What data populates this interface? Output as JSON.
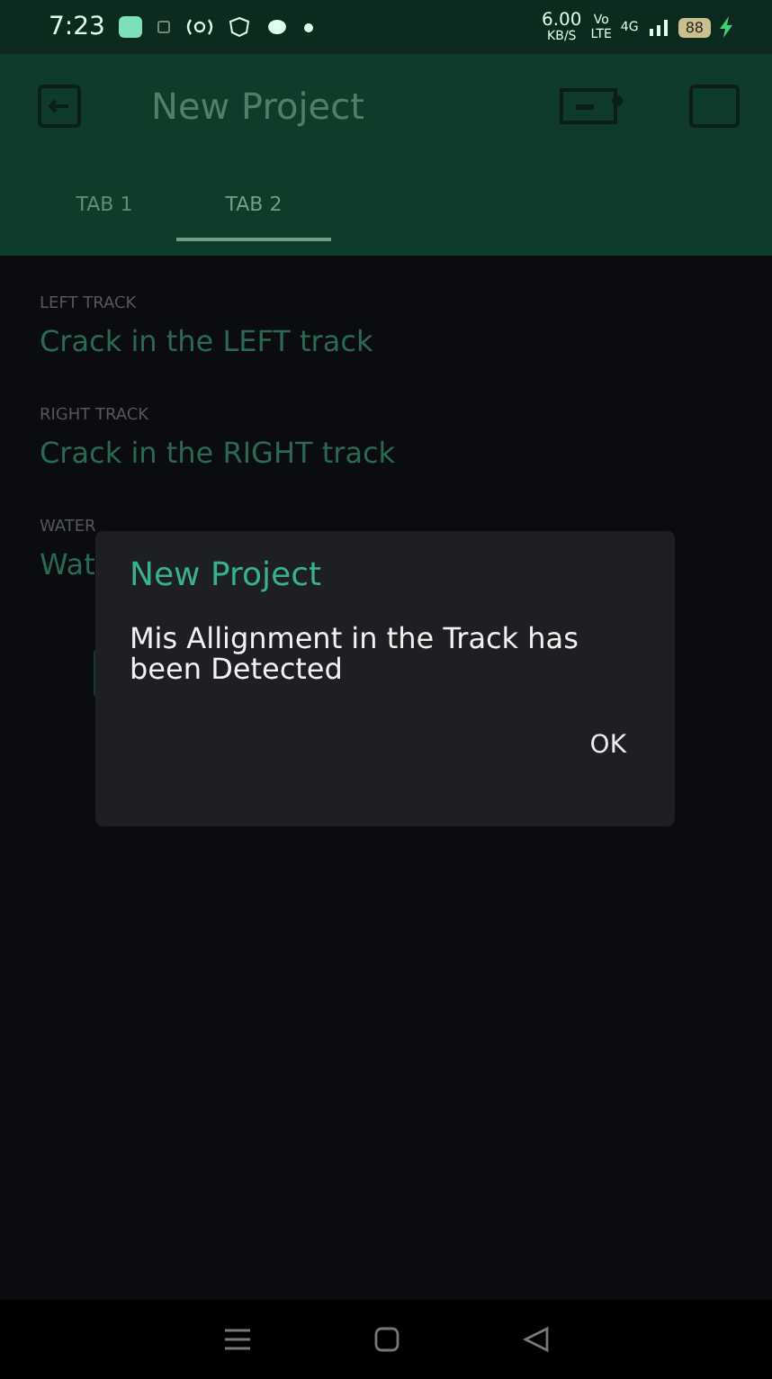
{
  "status_bar": {
    "time": "7:23",
    "net_speed": "6.00",
    "net_unit": "KB/S",
    "volte": "Vo",
    "lte": "LTE",
    "network": "4G",
    "battery": "88"
  },
  "app_bar": {
    "title": "New Project"
  },
  "tabs": [
    {
      "label": "TAB 1",
      "selected": false
    },
    {
      "label": "TAB 2",
      "selected": true
    }
  ],
  "fields": [
    {
      "label": "LEFT TRACK",
      "value": "Crack in the LEFT track"
    },
    {
      "label": "RIGHT TRACK",
      "value": "Crack in the RIGHT track"
    },
    {
      "label": "WATER",
      "value": "Wat"
    }
  ],
  "dialog": {
    "title": "New Project",
    "message": "Mis Allignment in the Track has been Detected",
    "button": "OK"
  }
}
